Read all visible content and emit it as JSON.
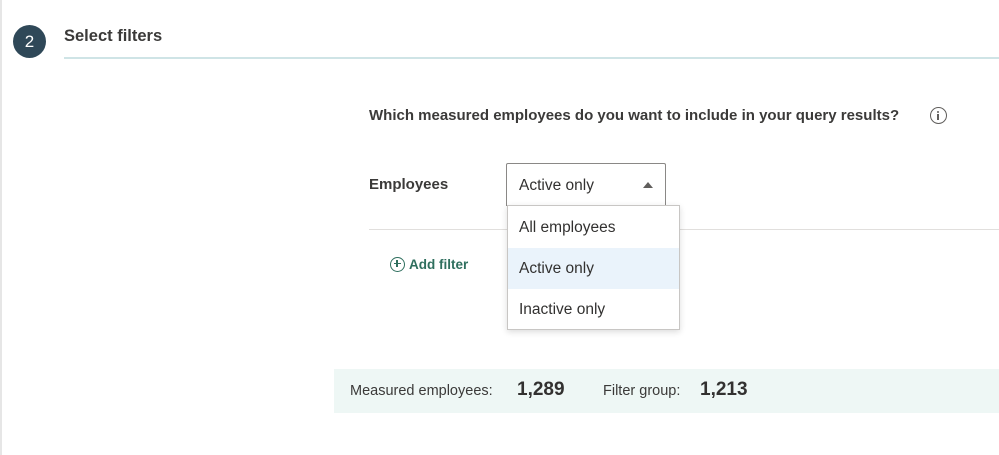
{
  "step": {
    "number": "2",
    "title": "Select filters"
  },
  "question": {
    "text": "Which measured employees do you want to include in your query results?",
    "icon": "info-icon"
  },
  "filter": {
    "label": "Employees",
    "selected": "Active only",
    "options": [
      "All employees",
      "Active only",
      "Inactive only"
    ],
    "selected_index": 1
  },
  "add_filter": {
    "label": "Add filter",
    "icon": "add-circle-icon"
  },
  "summary": {
    "measured_label": "Measured employees:",
    "measured_value": "1,289",
    "group_label": "Filter group:",
    "group_value": "1,213"
  },
  "colors": {
    "badge": "#2f4858",
    "accent_green": "#2f6f5e",
    "summary_bg": "#eef7f5",
    "selected_option_bg": "#eaf3fb"
  }
}
